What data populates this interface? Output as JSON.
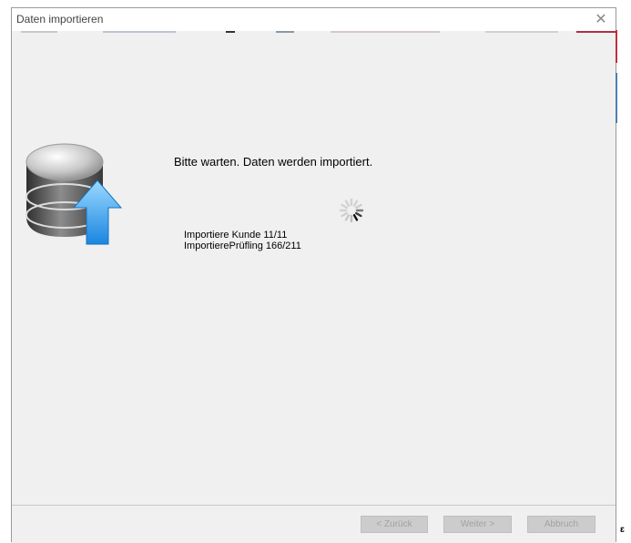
{
  "window": {
    "title": "Daten importieren",
    "close_glyph": "✕"
  },
  "main": {
    "wait_message": "Bitte warten. Daten werden importiert.",
    "progress": [
      "Importiere Kunde 11/11",
      "ImportierePrüfling 166/211"
    ]
  },
  "footer": {
    "back_label": "< Zurück",
    "next_label": "Weiter >",
    "cancel_label": "Abbruch"
  },
  "side_mark": "ɛ",
  "icons": {
    "app": "database-upload-icon",
    "spinner": "loading-spinner-icon",
    "close": "close-icon"
  }
}
